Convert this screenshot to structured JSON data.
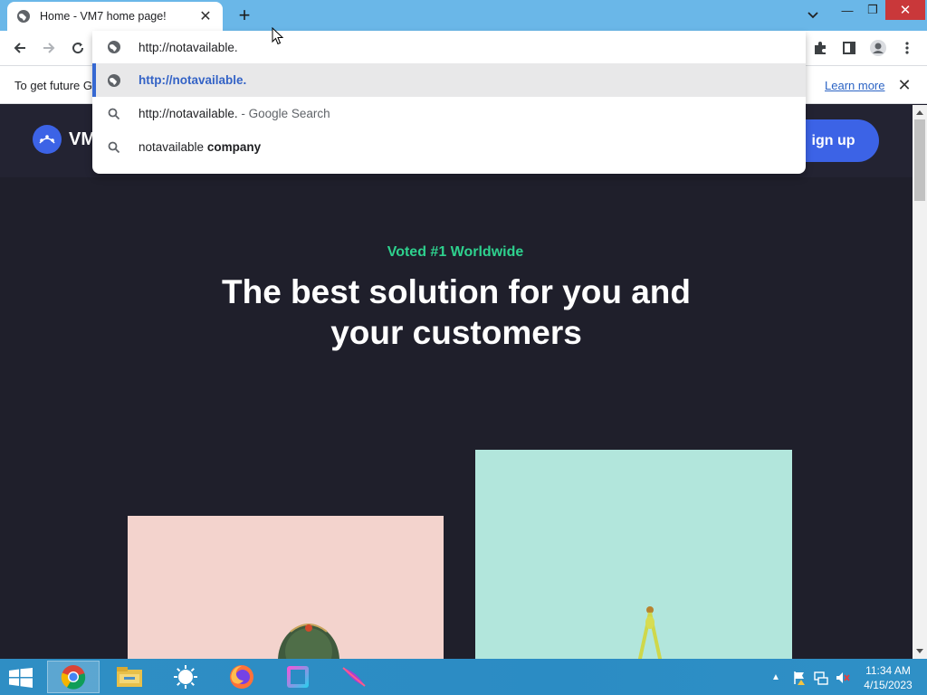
{
  "browser": {
    "tab": {
      "title": "Home - VM7 home page!"
    },
    "address_value": "http://notavailable.",
    "suggestions": [
      {
        "icon": "globe-icon",
        "main": "http://notavailable.",
        "suffix": ""
      },
      {
        "icon": "search-icon",
        "main": "http://notavailable.",
        "suffix": " - Google Search"
      },
      {
        "icon": "search-icon",
        "main": "notavailable ",
        "suffix": "company"
      }
    ],
    "infobar": {
      "message": "To get future G",
      "learn_more": "Learn more"
    },
    "accent_color": "#3668d2"
  },
  "site": {
    "brand": "VM",
    "signup": "ign up",
    "eyebrow": "Voted #1 Worldwide",
    "headline_line1": "The best solution for you and",
    "headline_line2": "your customers",
    "colors": {
      "background": "#1f1f2b",
      "button": "#3c63e6",
      "eyebrow": "#2ed18e"
    }
  },
  "taskbar": {
    "apps": [
      "chrome-icon",
      "file-explorer-icon",
      "weather-icon",
      "firefox-icon",
      "app-square-icon",
      "feather-app-icon"
    ],
    "clock_time": "11:34 AM",
    "clock_date": "4/15/2023"
  }
}
